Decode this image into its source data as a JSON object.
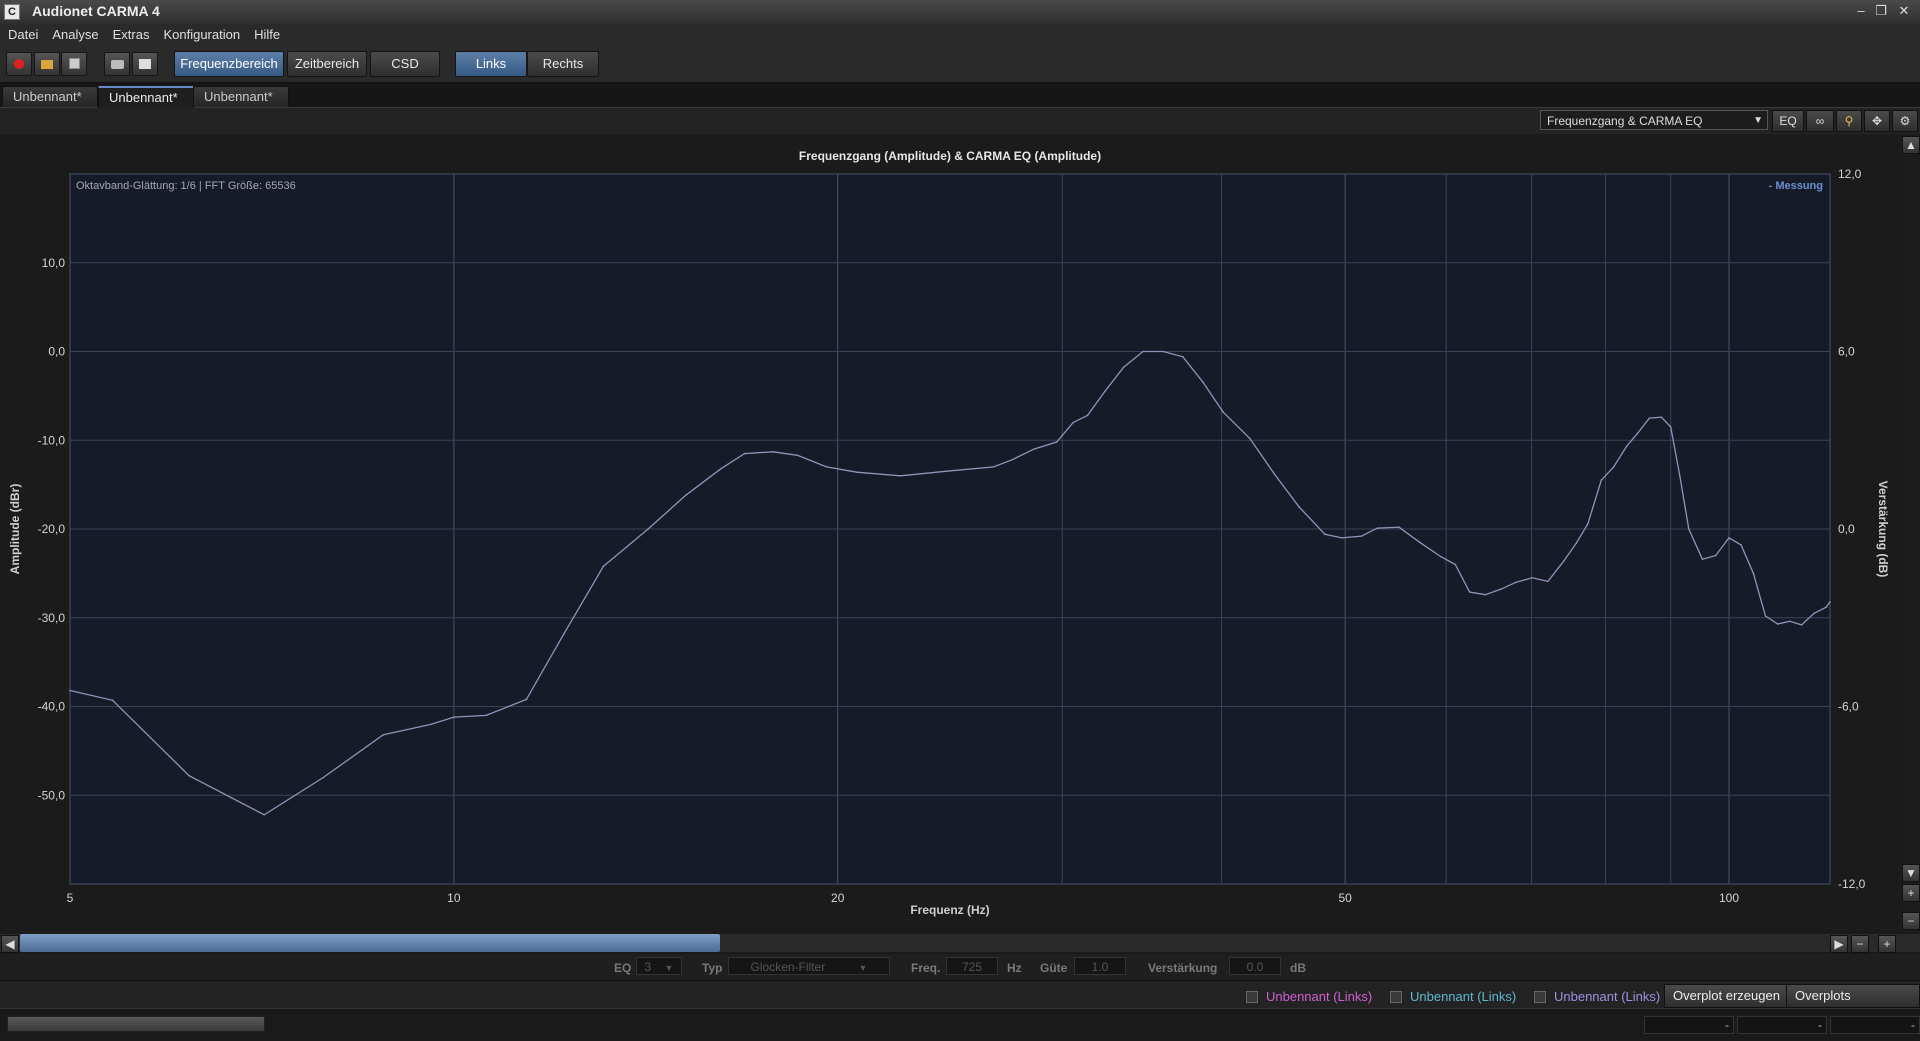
{
  "window": {
    "title": "Audionet CARMA 4",
    "app_icon_letter": "C",
    "controls": [
      "–",
      "❐",
      "✕"
    ]
  },
  "menu": [
    "Datei",
    "Analyse",
    "Extras",
    "Konfiguration",
    "Hilfe"
  ],
  "toolbar": {
    "icons": [
      "record-icon",
      "open-folder-icon",
      "save-icon",
      "screenshot-icon",
      "print-icon"
    ],
    "modes": [
      {
        "label": "Frequenzbereich",
        "active": true
      },
      {
        "label": "Zeitbereich",
        "active": false
      },
      {
        "label": "CSD",
        "active": false
      }
    ],
    "channels": [
      {
        "label": "Links",
        "active": true
      },
      {
        "label": "Rechts",
        "active": false
      }
    ]
  },
  "doc_tabs": [
    {
      "label": "Unbennant*",
      "active": false
    },
    {
      "label": "Unbennant*",
      "active": true,
      "close": "×"
    },
    {
      "label": "Unbennant*",
      "active": false
    }
  ],
  "view": {
    "selected": "Frequenzgang & CARMA EQ",
    "eq_button": "EQ",
    "link_icon": "chain-link-icon",
    "zoom_icon": "magnifier-icon",
    "pan_icon": "move-icon",
    "settings_icon": "gear-icon"
  },
  "chart_data": {
    "type": "line",
    "title": "Frequenzgang (Amplitude) & CARMA EQ (Amplitude)",
    "annotation": "Oktavband-Glättung: 1/6 | FFT Größe: 65536",
    "legend": [
      "- Messung"
    ],
    "legend_position": "top-right",
    "xlabel": "Frequenz (Hz)",
    "ylabel": "Amplitude (dBr)",
    "y2label": "Verstärkung (dB)",
    "xscale": "log",
    "xlim": [
      5,
      120
    ],
    "ylim": [
      -60,
      20
    ],
    "y2lim": [
      -12,
      12
    ],
    "grid": true,
    "x_ticks": [
      {
        "value": 5,
        "label": "5"
      },
      {
        "value": 10,
        "label": "10"
      },
      {
        "value": 20,
        "label": "20"
      },
      {
        "value": 50,
        "label": "50"
      },
      {
        "value": 100,
        "label": "100"
      }
    ],
    "x_minor_gridlines": [
      30,
      40,
      60,
      70,
      80,
      90
    ],
    "y_ticks": [
      {
        "value": 10,
        "label": "10,0"
      },
      {
        "value": 0,
        "label": "0,0"
      },
      {
        "value": -10,
        "label": "-10,0"
      },
      {
        "value": -20,
        "label": "-20,0"
      },
      {
        "value": -30,
        "label": "-30,0"
      },
      {
        "value": -40,
        "label": "-40,0"
      },
      {
        "value": -50,
        "label": "-50,0"
      }
    ],
    "y2_ticks": [
      {
        "value": 12,
        "label": "12,0"
      },
      {
        "value": 6,
        "label": "6,0"
      },
      {
        "value": 0,
        "label": "0,0"
      },
      {
        "value": -6,
        "label": "-6,0"
      },
      {
        "value": -12,
        "label": "-12,0"
      }
    ],
    "colors": {
      "line": "#8e95b8",
      "plot_bg": "#161b2a",
      "grid": "#3a4256",
      "legend": "#6d8fd1"
    },
    "series": [
      {
        "name": "Messung",
        "x": [
          5,
          5.4,
          6.2,
          7.1,
          7.9,
          8.8,
          9.6,
          10,
          10.6,
          11.4,
          12.2,
          13.1,
          14.2,
          15.2,
          16.2,
          16.9,
          17.8,
          18.6,
          19.6,
          20.7,
          22.4,
          24.3,
          26.5,
          27.4,
          28.5,
          29.7,
          30.6,
          31.4,
          32.4,
          33.5,
          34.7,
          36.0,
          37.3,
          38.7,
          40.1,
          42.1,
          44.0,
          46.0,
          48.2,
          49.7,
          51.5,
          53.0,
          55.1,
          57.2,
          59.4,
          61.0,
          62.6,
          64.4,
          66.2,
          68.1,
          70.1,
          72.1,
          74.2,
          75.9,
          77.5,
          79.4,
          81.2,
          83.1,
          84.8,
          86.6,
          88.5,
          90.0,
          91.5,
          93.0,
          95.3,
          97.6,
          100.0,
          102.2,
          104.5,
          106.8,
          109.2,
          111.6,
          114.0,
          116.6,
          119.2,
          120.0
        ],
        "y": [
          -38.2,
          -39.3,
          -47.8,
          -52.2,
          -48.0,
          -43.2,
          -42.0,
          -41.2,
          -41.0,
          -39.2,
          -31.8,
          -24.2,
          -20.0,
          -16.2,
          -13.2,
          -11.5,
          -11.3,
          -11.7,
          -13.0,
          -13.6,
          -14.0,
          -13.5,
          -13.0,
          -12.2,
          -11.0,
          -10.2,
          -8.0,
          -7.2,
          -4.5,
          -1.8,
          0.0,
          0.0,
          -0.6,
          -3.5,
          -6.8,
          -9.8,
          -13.8,
          -17.5,
          -20.6,
          -21.0,
          -20.8,
          -19.9,
          -19.8,
          -21.5,
          -23.1,
          -24.0,
          -27.1,
          -27.4,
          -26.8,
          -26.0,
          -25.5,
          -25.9,
          -23.6,
          -21.6,
          -19.4,
          -14.5,
          -13.0,
          -10.7,
          -9.2,
          -7.5,
          -7.4,
          -8.5,
          -14.0,
          -20.0,
          -23.4,
          -23.0,
          -21.0,
          -21.8,
          -25.0,
          -29.8,
          -30.7,
          -30.4,
          -30.8,
          -29.5,
          -28.8,
          -28.2
        ]
      }
    ]
  },
  "eq_editor": {
    "eq_label": "EQ",
    "eq_value": "3",
    "type_label": "Typ",
    "type_value": "Glocken-Filter",
    "freq_label": "Freq.",
    "freq_value": "725",
    "freq_unit": "Hz",
    "q_label": "Güte",
    "q_value": "1.0",
    "gain_label": "Verstärkung",
    "gain_value": "0.0",
    "gain_unit": "dB"
  },
  "overplots": {
    "items": [
      {
        "label": "Unbennant (Links)",
        "color": "#d060d0"
      },
      {
        "label": "Unbennant (Links)",
        "color": "#60b8d0"
      },
      {
        "label": "Unbennant (Links)",
        "color": "#a090e0"
      }
    ],
    "create_button": "Overplot erzeugen",
    "edit_button": "Overplots bearbeiten"
  },
  "status": {
    "fields": [
      "-",
      "-",
      "-"
    ]
  }
}
